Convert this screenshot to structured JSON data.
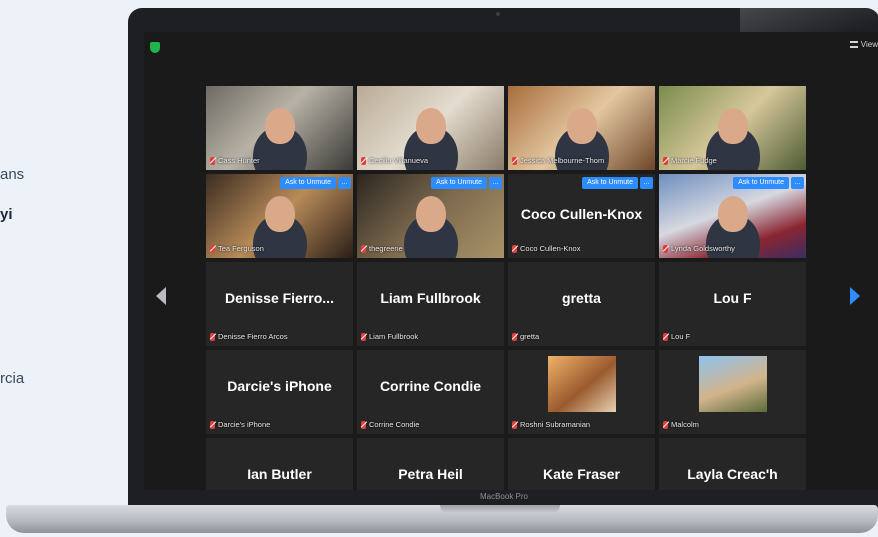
{
  "side_text": {
    "line1": "ans",
    "line2": "yi",
    "line3": "rcia"
  },
  "device": {
    "label": "MacBook Pro"
  },
  "toolbar": {
    "view_label": "View"
  },
  "tiles": [
    {
      "type": "video",
      "name": "Cass Hunter",
      "photo": "p0"
    },
    {
      "type": "video",
      "name": "Cecilia Villanueva",
      "photo": "p1"
    },
    {
      "type": "video",
      "name": "Jessica Melbourne-Thom",
      "photo": "p2"
    },
    {
      "type": "video",
      "name": "Marcie Fudge",
      "photo": "p3",
      "active": true
    },
    {
      "type": "video",
      "name": "Tea Ferguson",
      "photo": "p4",
      "ask": "Ask to Unmute",
      "more": "..."
    },
    {
      "type": "video",
      "name": "thegreene",
      "photo": "p5",
      "ask": "Ask to Unmute",
      "more": "..."
    },
    {
      "type": "text",
      "center": "Coco Cullen-Knox",
      "name": "Coco Cullen-Knox",
      "ask": "Ask to Unmute",
      "more": "...",
      "upper": true
    },
    {
      "type": "video",
      "name": "Lynda Goldsworthy",
      "photo": "p6",
      "ask": "Ask to Unmute",
      "more": "..."
    },
    {
      "type": "text",
      "center": "Denisse  Fierro...",
      "name": "Denisse Fierro Arcos"
    },
    {
      "type": "text",
      "center": "Liam Fullbrook",
      "name": "Liam Fullbrook"
    },
    {
      "type": "text",
      "center": "gretta",
      "name": "gretta"
    },
    {
      "type": "text",
      "center": "Lou F",
      "name": "Lou F"
    },
    {
      "type": "text",
      "center": "Darcie's iPhone",
      "name": "Darcie's iPhone"
    },
    {
      "type": "text",
      "center": "Corrine Condie",
      "name": "Corrine Condie"
    },
    {
      "type": "thumb",
      "name": "Roshni Subramanian",
      "thumb": "t-rosh"
    },
    {
      "type": "thumb",
      "name": "Malcolm",
      "thumb": "t-malc"
    },
    {
      "type": "text",
      "center": "Ian Butler",
      "name": ""
    },
    {
      "type": "text",
      "center": "Petra Heil",
      "name": ""
    },
    {
      "type": "text",
      "center": "Kate Fraser",
      "name": ""
    },
    {
      "type": "text",
      "center": "Layla Creac'h",
      "name": ""
    }
  ],
  "colors": {
    "accent": "#2d8cff",
    "active_border": "#c9e04a",
    "muted": "#e0403f",
    "secure": "#22b24c"
  },
  "icons": [
    "shield-icon",
    "grid-view-icon",
    "chevron-left-icon",
    "chevron-right-icon",
    "mic-muted-icon"
  ]
}
